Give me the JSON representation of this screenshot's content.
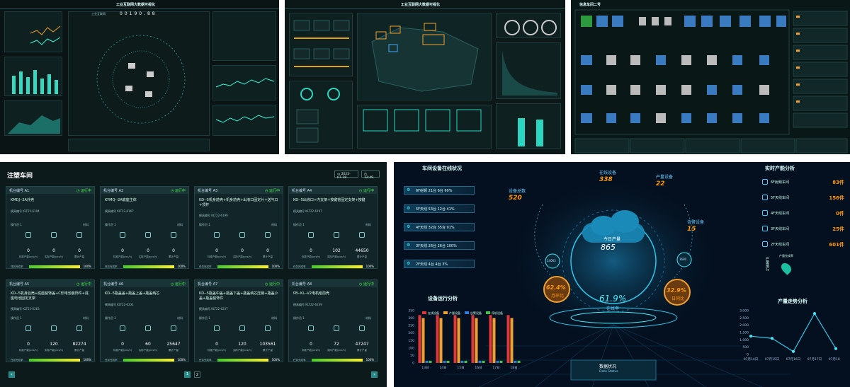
{
  "tile1": {
    "title": "工业互联网大数据可视化",
    "counter": "00190.88"
  },
  "tile2": {
    "title": "工业互联网大数据可视化"
  },
  "tile3": {
    "title": "信息车间二号"
  },
  "tile4": {
    "title": "注塑车间",
    "date": "2023-07-18",
    "time": "12:49",
    "prev_icon": "chevron-left-icon",
    "next_icon": "chevron-right-icon",
    "page": "1",
    "page2": "2",
    "cards": [
      {
        "label": "机台编号",
        "id": "A1",
        "status": "运行中",
        "name": "KMDJ--2A外壳",
        "code": "模具编号 KLT22-6104",
        "workers": "操作员 1",
        "mat": "材料",
        "vals": [
          "0",
          "0",
          "0"
        ],
        "vlabels": [
          "标准产能(pcs/h)",
          "实际产能(pcs/h)",
          "累计产量"
        ],
        "rate_label": "任务完成率",
        "pct": "100%",
        "fill": 1.0
      },
      {
        "label": "机台编号",
        "id": "A2",
        "status": "运行中",
        "name": "KYMQ--2A底座主体",
        "code": "模具编号 KLT22-6167",
        "workers": "操作员 1",
        "mat": "材料",
        "vals": [
          "0",
          "0",
          "0"
        ],
        "vlabels": [
          "标准产能(pcs/h)",
          "实际产能(pcs/h)",
          "累计产量"
        ],
        "rate_label": "任务完成率",
        "pct": "100%",
        "fill": 1.0
      },
      {
        "label": "机台编号",
        "id": "A3",
        "status": "运行中",
        "name": "KD--5机身前壳+机身前壳+出液口固定片+送气口+顶杆",
        "code": "模具编号 KLT22-6199",
        "workers": "操作员 1",
        "mat": "材料",
        "vals": [
          "0",
          "0",
          "0"
        ],
        "vlabels": [
          "标准产能(pcs/h)",
          "实际产能(pcs/h)",
          "累计产量"
        ],
        "rate_label": "任务完成率",
        "pct": "100%",
        "fill": 1.0
      },
      {
        "label": "机台编号",
        "id": "A4",
        "status": "运行中",
        "name": "KD--5出液口+内支架+按键管固定支架+按键",
        "code": "模具编号 KLT22-6197",
        "workers": "操作员 1",
        "mat": "材料",
        "vals": [
          "0",
          "102",
          "44650"
        ],
        "vlabels": [
          "标准产能(pcs/h)",
          "实际产能(pcs/h)",
          "累计产量"
        ],
        "rate_label": "任务完成率",
        "pct": "100%",
        "fill": 1.0
      },
      {
        "label": "机台编号",
        "id": "A5",
        "status": "运行中",
        "name": "KD--5机身后壳+底座装饰盖+C形电池装饰件+底座电池固定支架",
        "code": "模具编号 KLT22-6263",
        "workers": "操作员 1",
        "mat": "材料",
        "vals": [
          "0",
          "120",
          "82274"
        ],
        "vlabels": [
          "标准产能(pcs/h)",
          "实际产能(pcs/h)",
          "累计产量"
        ],
        "rate_label": "任务完成率",
        "pct": "100%",
        "fill": 1.0
      },
      {
        "label": "机台编号",
        "id": "A6",
        "status": "运行中",
        "name": "KD--5瓶盖盖+瓶盖上盖+瓶盖纳芯",
        "code": "模具编号 KLT22-6231",
        "workers": "操作员 1",
        "mat": "材料",
        "vals": [
          "0",
          "60",
          "25647"
        ],
        "vlabels": [
          "标准产能(pcs/h)",
          "实际产能(pcs/h)",
          "累计产量"
        ],
        "rate_label": "任务完成率",
        "pct": "100%",
        "fill": 1.0
      },
      {
        "label": "机台编号",
        "id": "A7",
        "status": "运行中",
        "name": "KD--5瓶盖中盖+瓶盖下盖+瓶盖纳芯压销+瓶盖小盖+瓶盖装饰件",
        "code": "模具编号 KLT22-6237",
        "workers": "操作员 1",
        "mat": "材料",
        "vals": [
          "0",
          "120",
          "103561"
        ],
        "vlabels": [
          "标准产能(pcs/h)",
          "实际产能(pcs/h)",
          "累计产量"
        ],
        "rate_label": "任务完成率",
        "pct": "100%",
        "fill": 1.0
      },
      {
        "label": "机台编号",
        "id": "A8",
        "status": "运行中",
        "name": "PB--KL--V2电机组前壳",
        "code": "模具编号 KLT22-6239",
        "workers": "操作员 1",
        "mat": "材料",
        "vals": [
          "0",
          "72",
          "47247"
        ],
        "vlabels": [
          "标准产能(pcs/h)",
          "实际产能(pcs/h)",
          "累计产量"
        ],
        "rate_label": "任务完成率",
        "pct": "100%",
        "fill": 1.0
      }
    ]
  },
  "tile5": {
    "left_title": "车间设备在线状况",
    "floors": [
      {
        "name": "6F射频",
        "text": "6F射频  21台 6台 69%"
      },
      {
        "name": "5F天线",
        "text": "5F天线  53台 12台 41%"
      },
      {
        "name": "4F天线",
        "text": "4F天线  32台 35台 91%"
      },
      {
        "name": "3F天线",
        "text": "3F天线  26台 26台 100%"
      },
      {
        "name": "2F天线",
        "text": "2F天线  4台 4台 3%"
      }
    ],
    "total_label": "设备总数",
    "total": "520",
    "online_label": "在线设备",
    "online": "338",
    "prod_label": "产量设备",
    "prod": "22",
    "alarm_label": "告警设备",
    "alarm": "15",
    "cloud_label": "今日产量",
    "cloud_val": "865",
    "online_rate": "61.9%",
    "online_rate_label": "在线率",
    "mom": "62.4%",
    "mom_label": "月环比",
    "yoy": "32.9%",
    "yoy_label": "日同比",
    "small_left": "24063",
    "small_right": "3680",
    "right_title": "实时产能分析",
    "cap_rows": [
      {
        "name": "6F射频车间",
        "value": "83件"
      },
      {
        "name": "5F天线车间",
        "value": "156件"
      },
      {
        "name": "4F天线车间",
        "value": "0件"
      },
      {
        "name": "3F天线车间",
        "value": "25件"
      },
      {
        "name": "2F天线车间",
        "value": "601件"
      }
    ],
    "cap_extra": "产量完成率",
    "cap_side": "产量排行",
    "run_title": "设备运行分析",
    "legend": [
      "在线设备",
      "产量设备",
      "告警设备",
      "停机设备"
    ],
    "trend_title": "产量走势分析",
    "data_status": "数据状况",
    "data_status_en": "Data Status"
  },
  "chart_data": [
    {
      "type": "bar",
      "title": "设备运行分析",
      "categories": [
        "13日",
        "14日",
        "15日",
        "16日",
        "17日",
        "18日"
      ],
      "ylim": [
        0,
        350
      ],
      "yticks": [
        "0",
        "50",
        "100",
        "150",
        "200",
        "250",
        "300",
        "350"
      ],
      "series": [
        {
          "name": "在线设备",
          "values": [
            320,
            320,
            320,
            320,
            320,
            320
          ]
        },
        {
          "name": "产量设备",
          "values": [
            300,
            300,
            300,
            300,
            300,
            300
          ]
        },
        {
          "name": "告警设备",
          "values": [
            15,
            15,
            15,
            15,
            15,
            15
          ]
        },
        {
          "name": "停机设备",
          "values": [
            15,
            15,
            15,
            15,
            15,
            15
          ]
        }
      ],
      "colors": [
        "#e0383a",
        "#f0a030",
        "#2e7ad8",
        "#48c048"
      ]
    },
    {
      "type": "line",
      "title": "产量走势分析",
      "categories": [
        "07月14日",
        "07月15日",
        "07月16日",
        "07月17日",
        "07月18日"
      ],
      "ylim": [
        0,
        3000
      ],
      "yticks": [
        "0",
        "500",
        "1,000",
        "1,500",
        "2,000",
        "2,500",
        "3,000"
      ],
      "series": [
        {
          "values": [
            1250,
            1100,
            200,
            2800,
            400
          ]
        }
      ]
    }
  ]
}
